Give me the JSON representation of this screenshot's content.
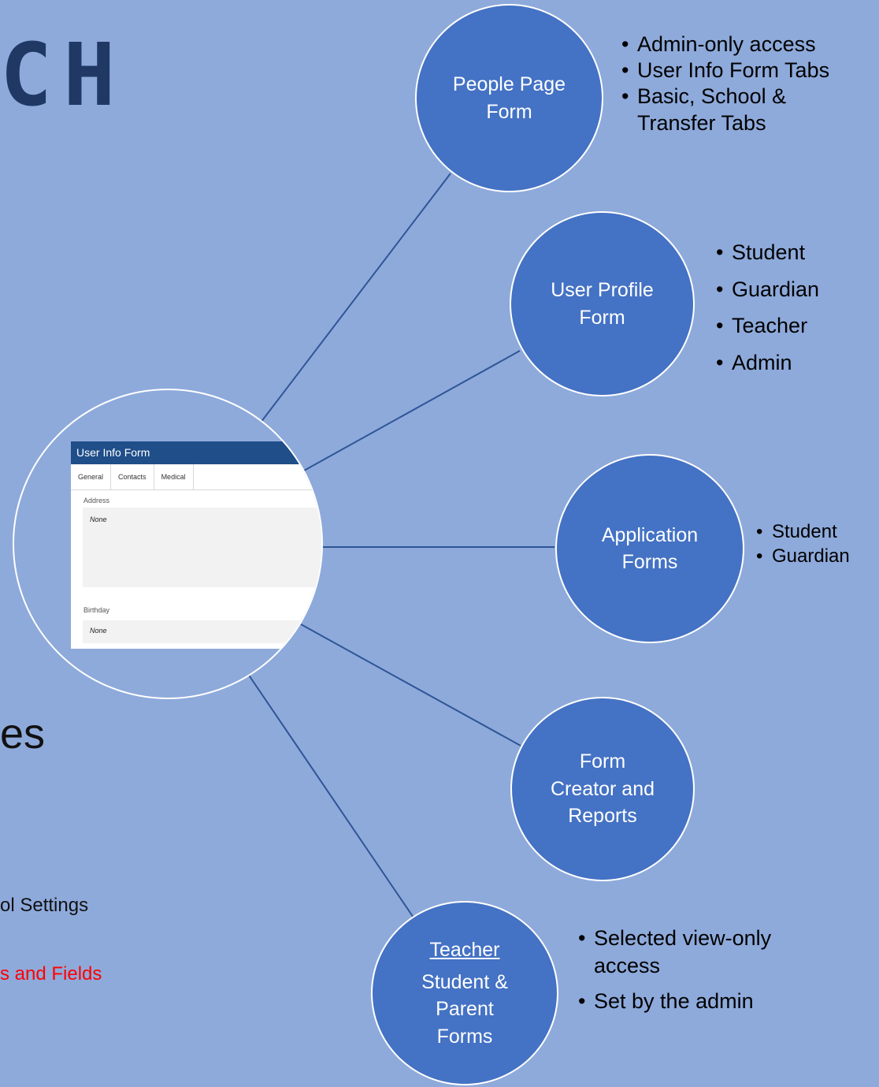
{
  "logo": {
    "text": "CH"
  },
  "left_fragments": {
    "heading": "es",
    "settings": "ol Settings",
    "fields": "s and Fields"
  },
  "center_form": {
    "title": "User Info Form",
    "tabs": [
      "General",
      "Contacts",
      "Medical"
    ],
    "address_label": "Address",
    "address_value": "None",
    "birthday_label": "Birthday",
    "birthday_value": "None"
  },
  "nodes": {
    "people_page": {
      "lines": [
        "People Page",
        "Form"
      ],
      "bullets": [
        "Admin-only access",
        "User Info Form Tabs",
        "Basic, School & Transfer Tabs"
      ]
    },
    "user_profile": {
      "lines": [
        "User Profile",
        "Form"
      ],
      "bullets": [
        "Student",
        "Guardian",
        "Teacher",
        "Admin"
      ]
    },
    "application": {
      "lines": [
        "Application",
        "Forms"
      ],
      "bullets": [
        "Student",
        "Guardian"
      ]
    },
    "form_creator": {
      "lines": [
        "Form",
        "Creator and",
        "Reports"
      ]
    },
    "teacher": {
      "underlined": "Teacher",
      "lines": [
        "Student &",
        "Parent",
        "Forms"
      ],
      "bullets": [
        "Selected view-only access",
        "Set by the admin"
      ]
    }
  },
  "colors": {
    "background": "#8eaadb",
    "circle_fill": "#4472c4",
    "connector": "#2f5597",
    "logo": "#1f3864",
    "form_titlebar": "#1f4e89",
    "highlight_text": "#ff0000"
  }
}
